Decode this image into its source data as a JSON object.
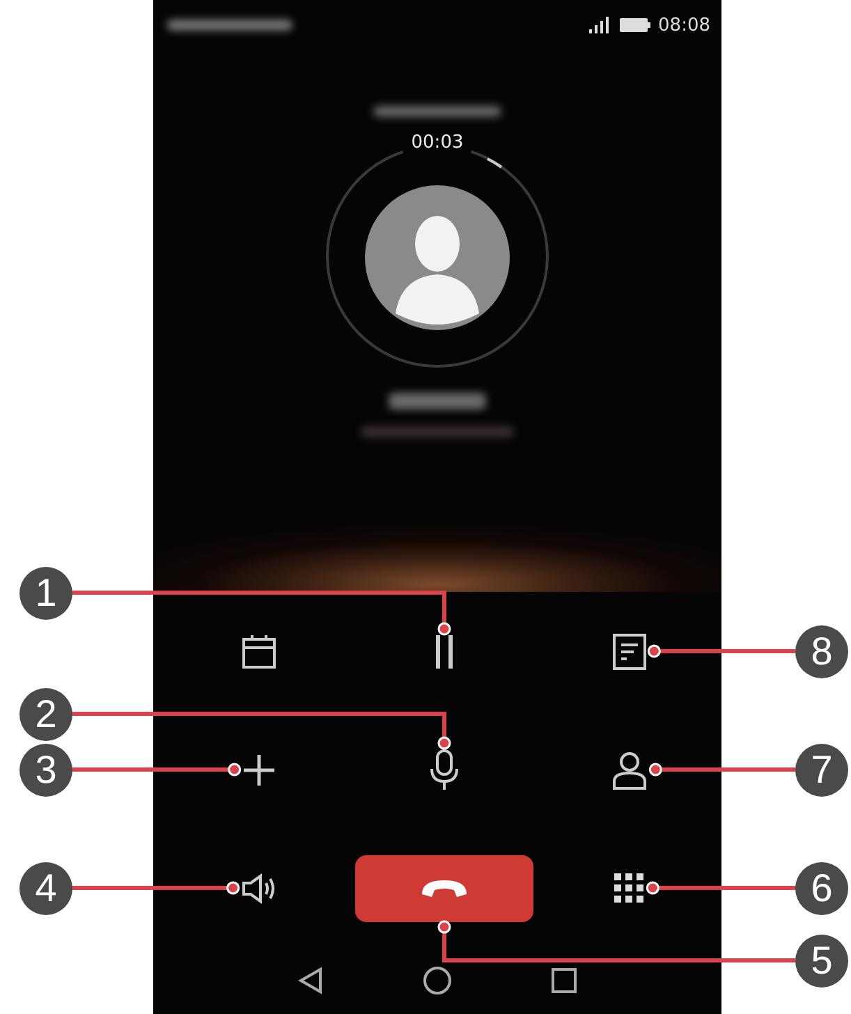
{
  "status_bar": {
    "time": "08:08"
  },
  "call": {
    "duration": "00:03"
  },
  "callouts": [
    {
      "label": "1"
    },
    {
      "label": "2"
    },
    {
      "label": "3"
    },
    {
      "label": "4"
    },
    {
      "label": "8"
    },
    {
      "label": "7"
    },
    {
      "label": "6"
    },
    {
      "label": "5"
    }
  ]
}
